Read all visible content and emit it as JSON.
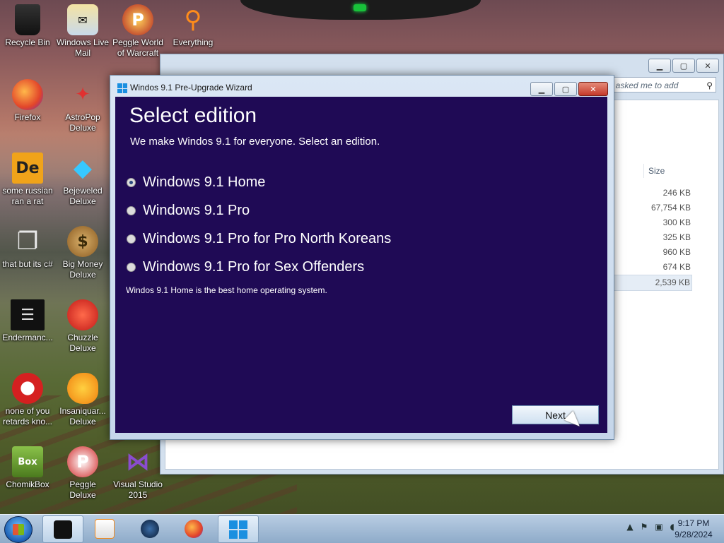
{
  "desktop": {
    "icons": [
      {
        "label": "Recycle Bin",
        "icon": "recycle-bin-icon"
      },
      {
        "label": "Windows Live Mail",
        "icon": "mail-icon"
      },
      {
        "label": "Peggle World of Warcraft",
        "icon": "peggle-icon"
      },
      {
        "label": "Everything",
        "icon": "search-magnifier-icon"
      },
      {
        "label": "Firefox",
        "icon": "firefox-icon"
      },
      {
        "label": "AstroPop Deluxe",
        "icon": "astropop-icon"
      },
      {
        "label": "some russian ran a rat",
        "icon": "de-icon"
      },
      {
        "label": "Bejeweled Deluxe",
        "icon": "gem-icon"
      },
      {
        "label": "that but its c#",
        "icon": "copy-icon"
      },
      {
        "label": "Big Money Deluxe",
        "icon": "money-bag-icon"
      },
      {
        "label": "Endermanc...",
        "icon": "list-icon"
      },
      {
        "label": "Chuzzle Deluxe",
        "icon": "chuzzle-icon"
      },
      {
        "label": "none of you retards kno...",
        "icon": "red-ball-icon"
      },
      {
        "label": "Insaniquar... Deluxe",
        "icon": "fish-icon"
      },
      {
        "label": "ChomikBox",
        "icon": "chomikbox-icon"
      },
      {
        "label": "Peggle Deluxe",
        "icon": "peggle-icon"
      },
      {
        "label": "Visual Studio 2015",
        "icon": "visual-studio-icon"
      }
    ]
  },
  "explorer": {
    "search_placeholder": "le asked me to add",
    "size_header": "Size",
    "sizes": [
      "246 KB",
      "67,754 KB",
      "300 KB",
      "325 KB",
      "960 KB",
      "674 KB",
      "2,539 KB"
    ]
  },
  "wizard": {
    "title": "Windos 9.1 Pre-Upgrade Wizard",
    "heading": "Select edition",
    "subheading": "We make Windos 9.1 for everyone. Select an edition.",
    "options": [
      {
        "label": "Windows 9.1 Home",
        "selected": true
      },
      {
        "label": "Windows 9.1 Pro",
        "selected": false
      },
      {
        "label": "Windows 9.1 Pro for Pro North Koreans",
        "selected": false
      },
      {
        "label": "Windows 9.1 Pro for Sex Offenders",
        "selected": false
      }
    ],
    "description": "Windos 9.1 Home is the best home operating system.",
    "next_label": "Next"
  },
  "taskbar": {
    "time": "9:17 PM",
    "date": "9/28/2024"
  }
}
